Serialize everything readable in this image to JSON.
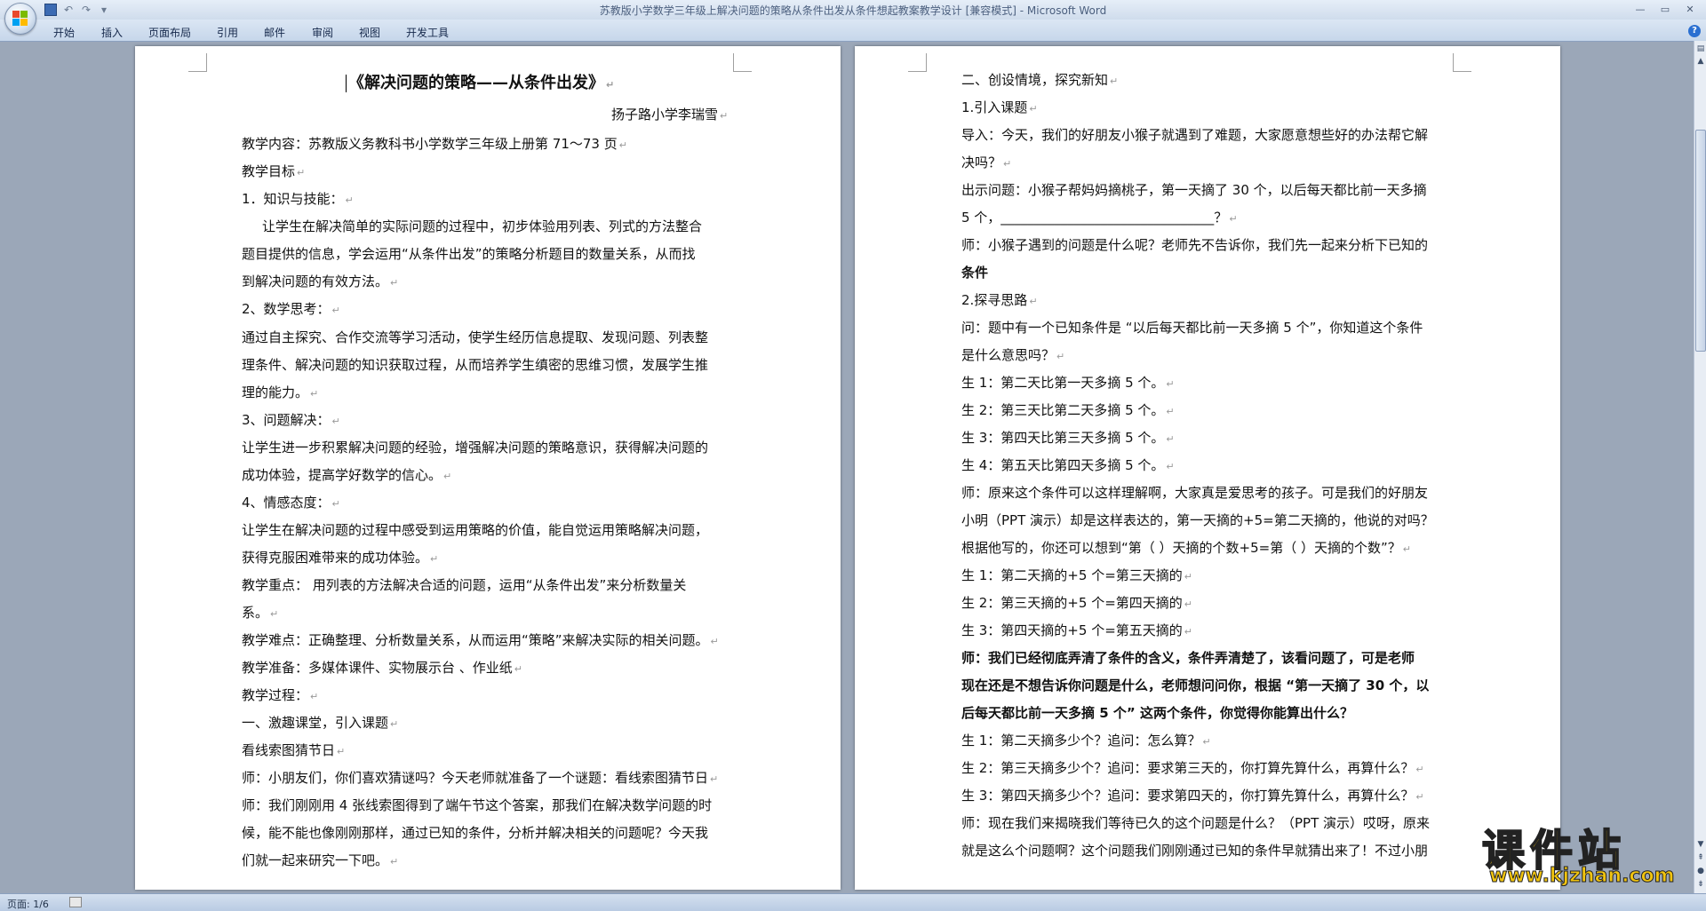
{
  "window": {
    "title": "苏教版小学数学三年级上解决问题的策略从条件出发从条件想起教案教学设计 [兼容模式] - Microsoft Word",
    "minimize": "—",
    "maximize": "▭",
    "close": "✕"
  },
  "ribbon": {
    "tabs": [
      "开始",
      "插入",
      "页面布局",
      "引用",
      "邮件",
      "审阅",
      "视图",
      "开发工具"
    ]
  },
  "status": {
    "page": "页面: 1/6"
  },
  "watermark": {
    "main": "课件站",
    "url": "www.kjzhan.com"
  },
  "page1": {
    "lines": [
      "《解决问题的策略——从条件出发》",
      "扬子路小学李瑞雪",
      "教学内容：苏教版义务教科书小学数学三年级上册第 71～73 页",
      "教学目标",
      "1．知识与技能：",
      "让学生在解决简单的实际问题的过程中，初步体验用列表、列式的方法整合",
      "题目提供的信息，学会运用“从条件出发”的策略分析题目的数量关系，从而找",
      "到解决问题的有效方法。",
      "2、数学思考：",
      "通过自主探究、合作交流等学习活动，使学生经历信息提取、发现问题、列表整",
      "理条件、解决问题的知识获取过程，从而培养学生缜密的思维习惯，发展学生推",
      "理的能力。",
      "3、问题解决：",
      "让学生进一步积累解决问题的经验，增强解决问题的策略意识，获得解决问题的",
      "成功体验，提高学好数学的信心。",
      "4、情感态度：",
      "让学生在解决问题的过程中感受到运用策略的价值，能自觉运用策略解决问题，",
      "获得克服困难带来的成功体验。",
      "教学重点：  用列表的方法解决合适的问题，运用“从条件出发”来分析数量关",
      "系。",
      "教学难点：正确整理、分析数量关系，从而运用“策略”来解决实际的相关问题。",
      "教学准备：多媒体课件、实物展示台 、作业纸",
      "教学过程：",
      "一、激趣课堂，引入课题",
      "看线索图猜节日",
      "师：小朋友们，你们喜欢猜谜吗？今天老师就准备了一个谜题：看线索图猜节日",
      "师：我们刚刚用 4 张线索图得到了端午节这个答案，那我们在解决数学问题的时",
      "候，能不能也像刚刚那样，通过已知的条件，分析并解决相关的问题呢？今天我",
      "们就一起来研究一下吧。"
    ]
  },
  "page2": {
    "lines": [
      "二、创设情境，探究新知",
      "1.引入课题",
      "导入：今天，我们的好朋友小猴子就遇到了难题，大家愿意想些好的办法帮它解",
      "决吗？",
      "出示问题：小猴子帮妈妈摘桃子，第一天摘了 30 个，以后每天都比前一天多摘",
      "5 个，________________________________？",
      "师：小猴子遇到的问题是什么呢？老师先不告诉你，我们先一起来分析下已知的",
      "条件",
      "2.探寻思路",
      "问：题中有一个已知条件是 “以后每天都比前一天多摘 5 个”，你知道这个条件",
      "是什么意思吗？",
      "生 1：第二天比第一天多摘 5 个。",
      "生 2：第三天比第二天多摘 5 个。",
      "生 3：第四天比第三天多摘 5 个。",
      "生 4：第五天比第四天多摘 5 个。",
      "师：原来这个条件可以这样理解啊，大家真是爱思考的孩子。可是我们的好朋友",
      "小明（PPT 演示）却是这样表达的，第一天摘的+5=第二天摘的，他说的对吗？",
      "根据他写的，你还可以想到“第（     ）天摘的个数+5=第（     ）天摘的个数”？",
      "生 1：第二天摘的+5 个=第三天摘的",
      "生 2：第三天摘的+5 个=第四天摘的",
      "生 3：第四天摘的+5 个=第五天摘的",
      "师：我们已经彻底弄清了条件的含义，条件弄清楚了，该看问题了，可是老师",
      "现在还是不想告诉你问题是什么，老师想问问你，根据 “第一天摘了 30 个，以",
      "后每天都比前一天多摘 5 个” 这两个条件，你觉得你能算出什么？",
      "生 1：第二天摘多少个？追问：怎么算？",
      "生 2：第三天摘多少个？追问：要求第三天的，你打算先算什么，再算什么？",
      "生 3：第四天摘多少个？追问：要求第四天的，你打算先算什么，再算什么？",
      "师：现在我们来揭晓我们等待已久的这个问题是什么？（PPT 演示）哎呀，原来",
      "就是这么个问题啊？这个问题我们刚刚通过已知的条件早就猜出来了！不过小朋"
    ]
  }
}
